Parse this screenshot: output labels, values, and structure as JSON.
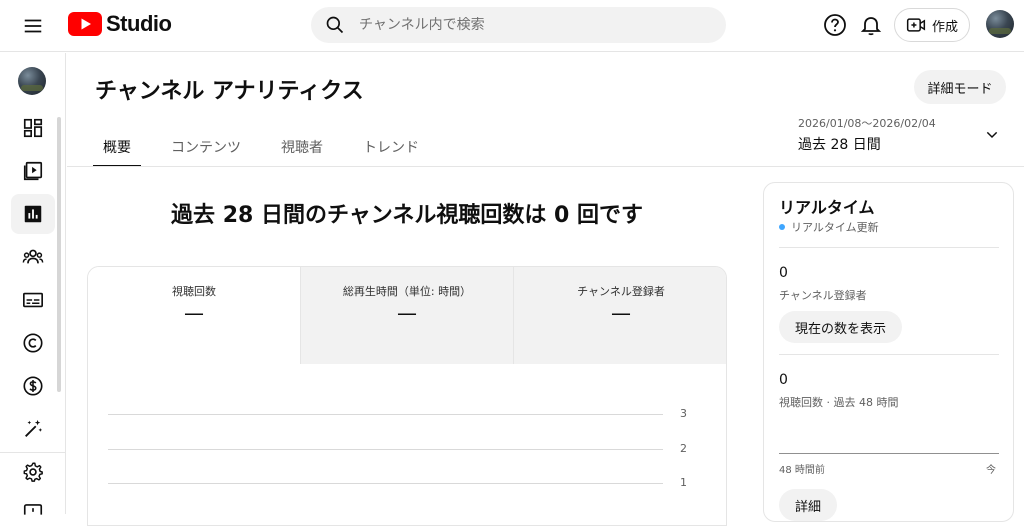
{
  "topbar": {
    "logo_text": "Studio",
    "search_placeholder": "チャンネル内で検索",
    "create_label": "作成"
  },
  "page": {
    "title": "チャンネル アナリティクス",
    "detail_mode_label": "詳細モード",
    "tabs": [
      {
        "label": "概要",
        "active": true
      },
      {
        "label": "コンテンツ",
        "active": false
      },
      {
        "label": "視聴者",
        "active": false
      },
      {
        "label": "トレンド",
        "active": false
      }
    ],
    "date_range": "2026/01/08〜2026/02/04",
    "date_period": "過去 28 日間",
    "headline": "過去 28 日間のチャンネル視聴回数は 0 回です"
  },
  "metrics": [
    {
      "label": "視聴回数",
      "value": "—"
    },
    {
      "label": "総再生時間（単位: 時間）",
      "value": "—"
    },
    {
      "label": "チャンネル登録者",
      "value": "—"
    }
  ],
  "chart": {
    "ticks": [
      "3",
      "2",
      "1"
    ]
  },
  "realtime": {
    "title": "リアルタイム",
    "live_label": "リアルタイム更新",
    "subscribers_value": "0",
    "subscribers_label": "チャンネル登録者",
    "show_count_label": "現在の数を表示",
    "views_value": "0",
    "views_label": "視聴回数 · 過去 48 時間",
    "axis_left": "48 時間前",
    "axis_right": "今",
    "details_label": "詳細"
  },
  "colors": {
    "brand_red": "#ff0000",
    "live_dot": "#3ea6ff"
  }
}
